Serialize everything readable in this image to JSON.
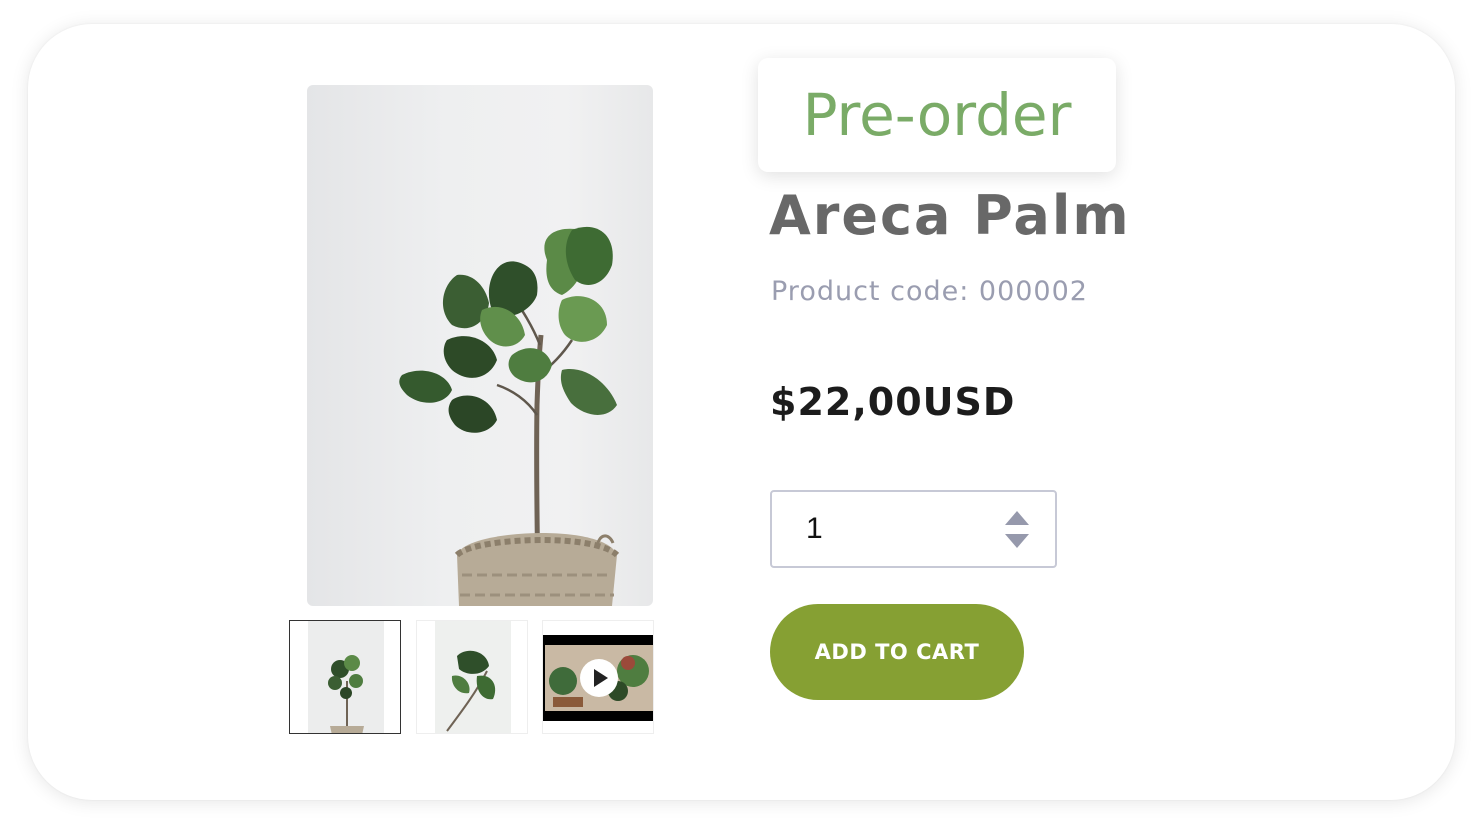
{
  "badge": {
    "label": "Pre-order",
    "color": "#7aab67"
  },
  "product": {
    "name": "Areca Palm",
    "code_line": "Product code: 000002",
    "price": "$22,00USD",
    "quantity": "1"
  },
  "actions": {
    "add_to_cart": "ADD TO CART",
    "button_color": "#86a033"
  },
  "gallery": {
    "main_image": "fiddle-leaf-plant-in-basket",
    "thumbnails": [
      {
        "kind": "image",
        "subject": "plant-in-basket",
        "selected": true
      },
      {
        "kind": "image",
        "subject": "plant-leaves",
        "selected": false
      },
      {
        "kind": "video",
        "subject": "plant-shop-video",
        "selected": false
      }
    ]
  },
  "icons": {
    "quantity_up": "triangle-up-icon",
    "quantity_down": "triangle-down-icon",
    "video_play": "play-icon"
  }
}
